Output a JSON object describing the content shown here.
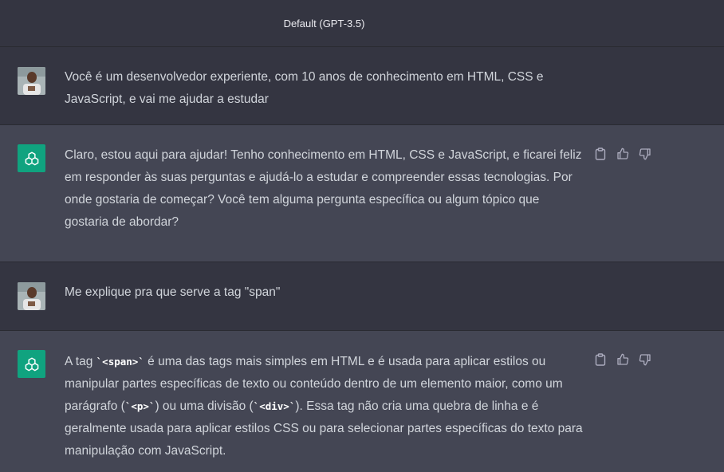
{
  "header": {
    "model_label": "Default (GPT-3.5)"
  },
  "messages": [
    {
      "role": "user",
      "text": "Você é um desenvolvedor experiente, com 10 anos de conhecimento em HTML, CSS e JavaScript, e vai me ajudar a estudar"
    },
    {
      "role": "assistant",
      "text": "Claro, estou aqui para ajudar! Tenho conhecimento em HTML, CSS e JavaScript, e ficarei feliz em responder às suas perguntas e ajudá-lo a estudar e compreender essas tecnologias. Por onde gostaria de começar? Você tem alguma pergunta específica ou algum tópico que gostaria de abordar?"
    },
    {
      "role": "user",
      "text": "Me explique pra que serve a tag \"span\""
    },
    {
      "role": "assistant",
      "parts": {
        "p1": "A tag ",
        "c1": "`<span>`",
        "p2": " é uma das tags mais simples em HTML e é usada para aplicar estilos ou manipular partes específicas de texto ou conteúdo dentro de um elemento maior, como um parágrafo (",
        "c2": "`<p>`",
        "p3": ") ou uma divisão (",
        "c3": "`<div>`",
        "p4": "). Essa tag não cria uma quebra de linha e é geralmente usada para aplicar estilos CSS ou para selecionar partes específicas do texto para manipulação com JavaScript."
      }
    }
  ],
  "icons": {
    "gpt_avatar": "openai-logo-icon",
    "copy": "clipboard-icon",
    "like": "thumbs-up-icon",
    "dislike": "thumbs-down-icon"
  },
  "colors": {
    "accent": "#10a37f",
    "assistant_bg": "#444654",
    "user_bg": "#343541"
  }
}
